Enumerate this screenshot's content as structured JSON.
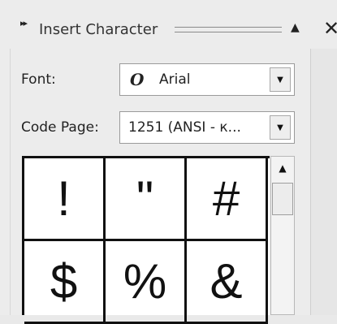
{
  "titlebar": {
    "arrows": "▸▸",
    "title": "Insert Character",
    "up_icon": "▲",
    "close_icon": "✕"
  },
  "font": {
    "label": "Font:",
    "glyph": "O",
    "value": "Arial",
    "dropdown_icon": "▼"
  },
  "code_page": {
    "label": "Code Page:",
    "value": "1251  (ANSI - к...",
    "dropdown_icon": "▼"
  },
  "characters": [
    "!",
    "\"",
    "#",
    "$",
    "%",
    "&"
  ],
  "scrollbar": {
    "up_icon": "▲"
  }
}
